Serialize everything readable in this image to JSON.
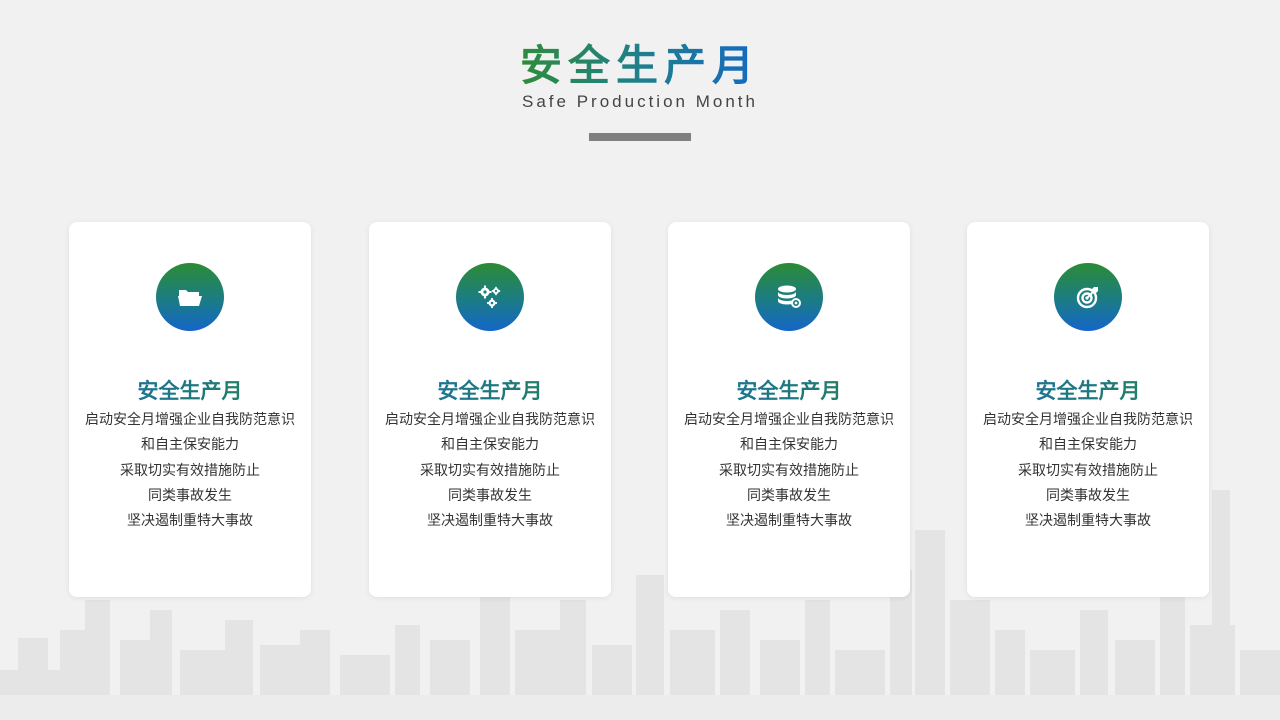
{
  "header": {
    "title": "安全生产月",
    "subtitle": "Safe Production Month"
  },
  "colors": {
    "background": "#f1f1f1",
    "card": "#ffffff",
    "gradient_green": "#2c8b35",
    "gradient_blue": "#1466c9",
    "divider": "#7f7f7f"
  },
  "cards": [
    {
      "icon": "folder-open-icon",
      "title": "安全生产月",
      "lines": [
        "启动安全月增强企业自我防范意识",
        "和自主保安能力",
        "采取切实有效措施防止",
        "同类事故发生",
        "坚决遏制重特大事故"
      ]
    },
    {
      "icon": "gears-icon",
      "title": "安全生产月",
      "lines": [
        "启动安全月增强企业自我防范意识",
        "和自主保安能力",
        "采取切实有效措施防止",
        "同类事故发生",
        "坚决遏制重特大事故"
      ]
    },
    {
      "icon": "database-gear-icon",
      "title": "安全生产月",
      "lines": [
        "启动安全月增强企业自我防范意识",
        "和自主保安能力",
        "采取切实有效措施防止",
        "同类事故发生",
        "坚决遏制重特大事故"
      ]
    },
    {
      "icon": "target-icon",
      "title": "安全生产月",
      "lines": [
        "启动安全月增强企业自我防范意识",
        "和自主保安能力",
        "采取切实有效措施防止",
        "同类事故发生",
        "坚决遏制重特大事故"
      ]
    }
  ]
}
